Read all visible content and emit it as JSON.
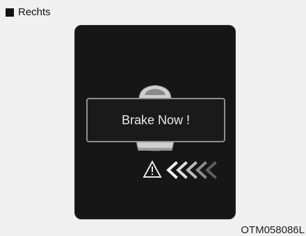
{
  "section": {
    "title": "Rechts"
  },
  "display": {
    "warning_text": "Brake Now !",
    "icons": [
      "car-front-icon",
      "warning-triangle-icon",
      "approach-chevrons-icon"
    ]
  },
  "figure_code": "OTM058086L",
  "colors": {
    "panel": "#161616",
    "text": "#e9e9e9",
    "frame": "#8f8f8f"
  }
}
